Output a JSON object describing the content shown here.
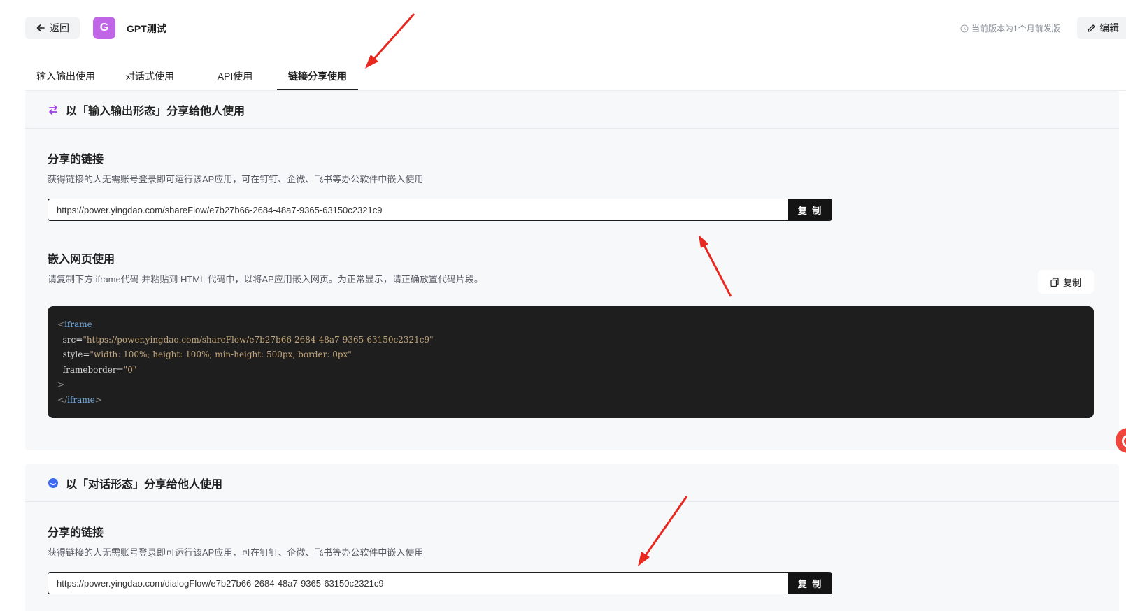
{
  "header": {
    "back_label": "返回",
    "app_avatar_letter": "G",
    "app_name": "GPT测试",
    "version_text": "当前版本为1个月前发版",
    "edit_label": "编辑"
  },
  "tabs": [
    {
      "label": "输入输出使用",
      "active": false
    },
    {
      "label": "对话式使用",
      "active": false
    },
    {
      "label": "API使用",
      "active": false
    },
    {
      "label": "链接分享使用",
      "active": true
    }
  ],
  "section_io": {
    "title": "以「输入输出形态」分享给他人使用",
    "share_title": "分享的链接",
    "share_desc": "获得链接的人无需账号登录即可运行该AP应用，可在钉钉、企微、飞书等办公软件中嵌入使用",
    "share_url": "https://power.yingdao.com/shareFlow/e7b27b66-2684-48a7-9365-63150c2321c9",
    "copy_label": "复 制",
    "embed_title": "嵌入网页使用",
    "embed_desc": "请复制下方 iframe代码 并粘贴到 HTML 代码中，以将AP应用嵌入网页。为正常显示，请正确放置代码片段。",
    "embed_copy_label": "复制",
    "code": {
      "open": "<",
      "tag": "iframe",
      "src_attr": "src=",
      "src_val": "\"https://power.yingdao.com/shareFlow/e7b27b66-2684-48a7-9365-63150c2321c9\"",
      "style_attr": "style=",
      "style_val": "\"width: 100%; height: 100%; min-height: 500px; border: 0px\"",
      "fb_attr": "frameborder=",
      "fb_val": "\"0\"",
      "close_gt": ">",
      "close_open": "</",
      "close_tag": "iframe",
      "close_end": ">"
    }
  },
  "section_dialog": {
    "title": "以「对话形态」分享给他人使用",
    "share_title": "分享的链接",
    "share_desc": "获得链接的人无需账号登录即可运行该AP应用，可在钉钉、企微、飞书等办公软件中嵌入使用",
    "share_url": "https://power.yingdao.com/dialogFlow/e7b27b66-2684-48a7-9365-63150c2321c9",
    "copy_label": "复 制"
  },
  "colors": {
    "avatar": "#c065e6",
    "annotation_arrow": "#e8281e",
    "io_icon": "#9b3fe0",
    "dialog_icon": "#3d6cf0"
  }
}
